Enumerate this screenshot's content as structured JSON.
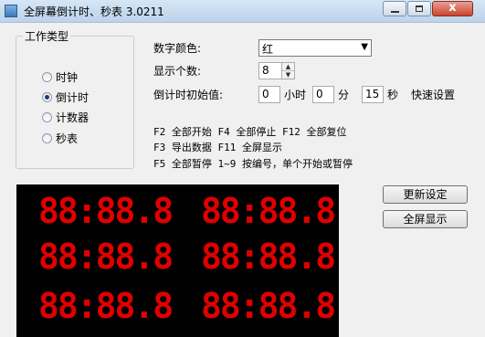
{
  "window": {
    "title": "全屏幕倒计时、秒表 3.0211",
    "close_glyph": "x"
  },
  "work_type": {
    "title": "工作类型",
    "options": [
      {
        "label": "时钟",
        "selected": false
      },
      {
        "label": "倒计时",
        "selected": true
      },
      {
        "label": "计数器",
        "selected": false
      },
      {
        "label": "秒表",
        "selected": false
      }
    ]
  },
  "settings": {
    "color_label": "数字颜色:",
    "color_value": "红",
    "count_label": "显示个数:",
    "count_value": "8",
    "init_label": "倒计时初始值:",
    "hours_value": "0",
    "hours_unit": "小时",
    "minutes_value": "0",
    "minutes_unit": "分",
    "seconds_value": "15",
    "seconds_unit": "秒",
    "quick_set": "快速设置"
  },
  "shortcuts": [
    "F2 全部开始 F4 全部停止 F12 全部复位",
    "F3 导出数据 F11 全屏显示",
    "F5 全部暂停 1~9 按编号，单个开始或暂停"
  ],
  "display": {
    "color": "#e00000",
    "timers": [
      "88:88.8",
      "88:88.8",
      "88:88.8",
      "88:88.8",
      "88:88.8",
      "88:88.8"
    ]
  },
  "buttons": {
    "update": "更新设定",
    "fullscreen": "全屏显示"
  }
}
